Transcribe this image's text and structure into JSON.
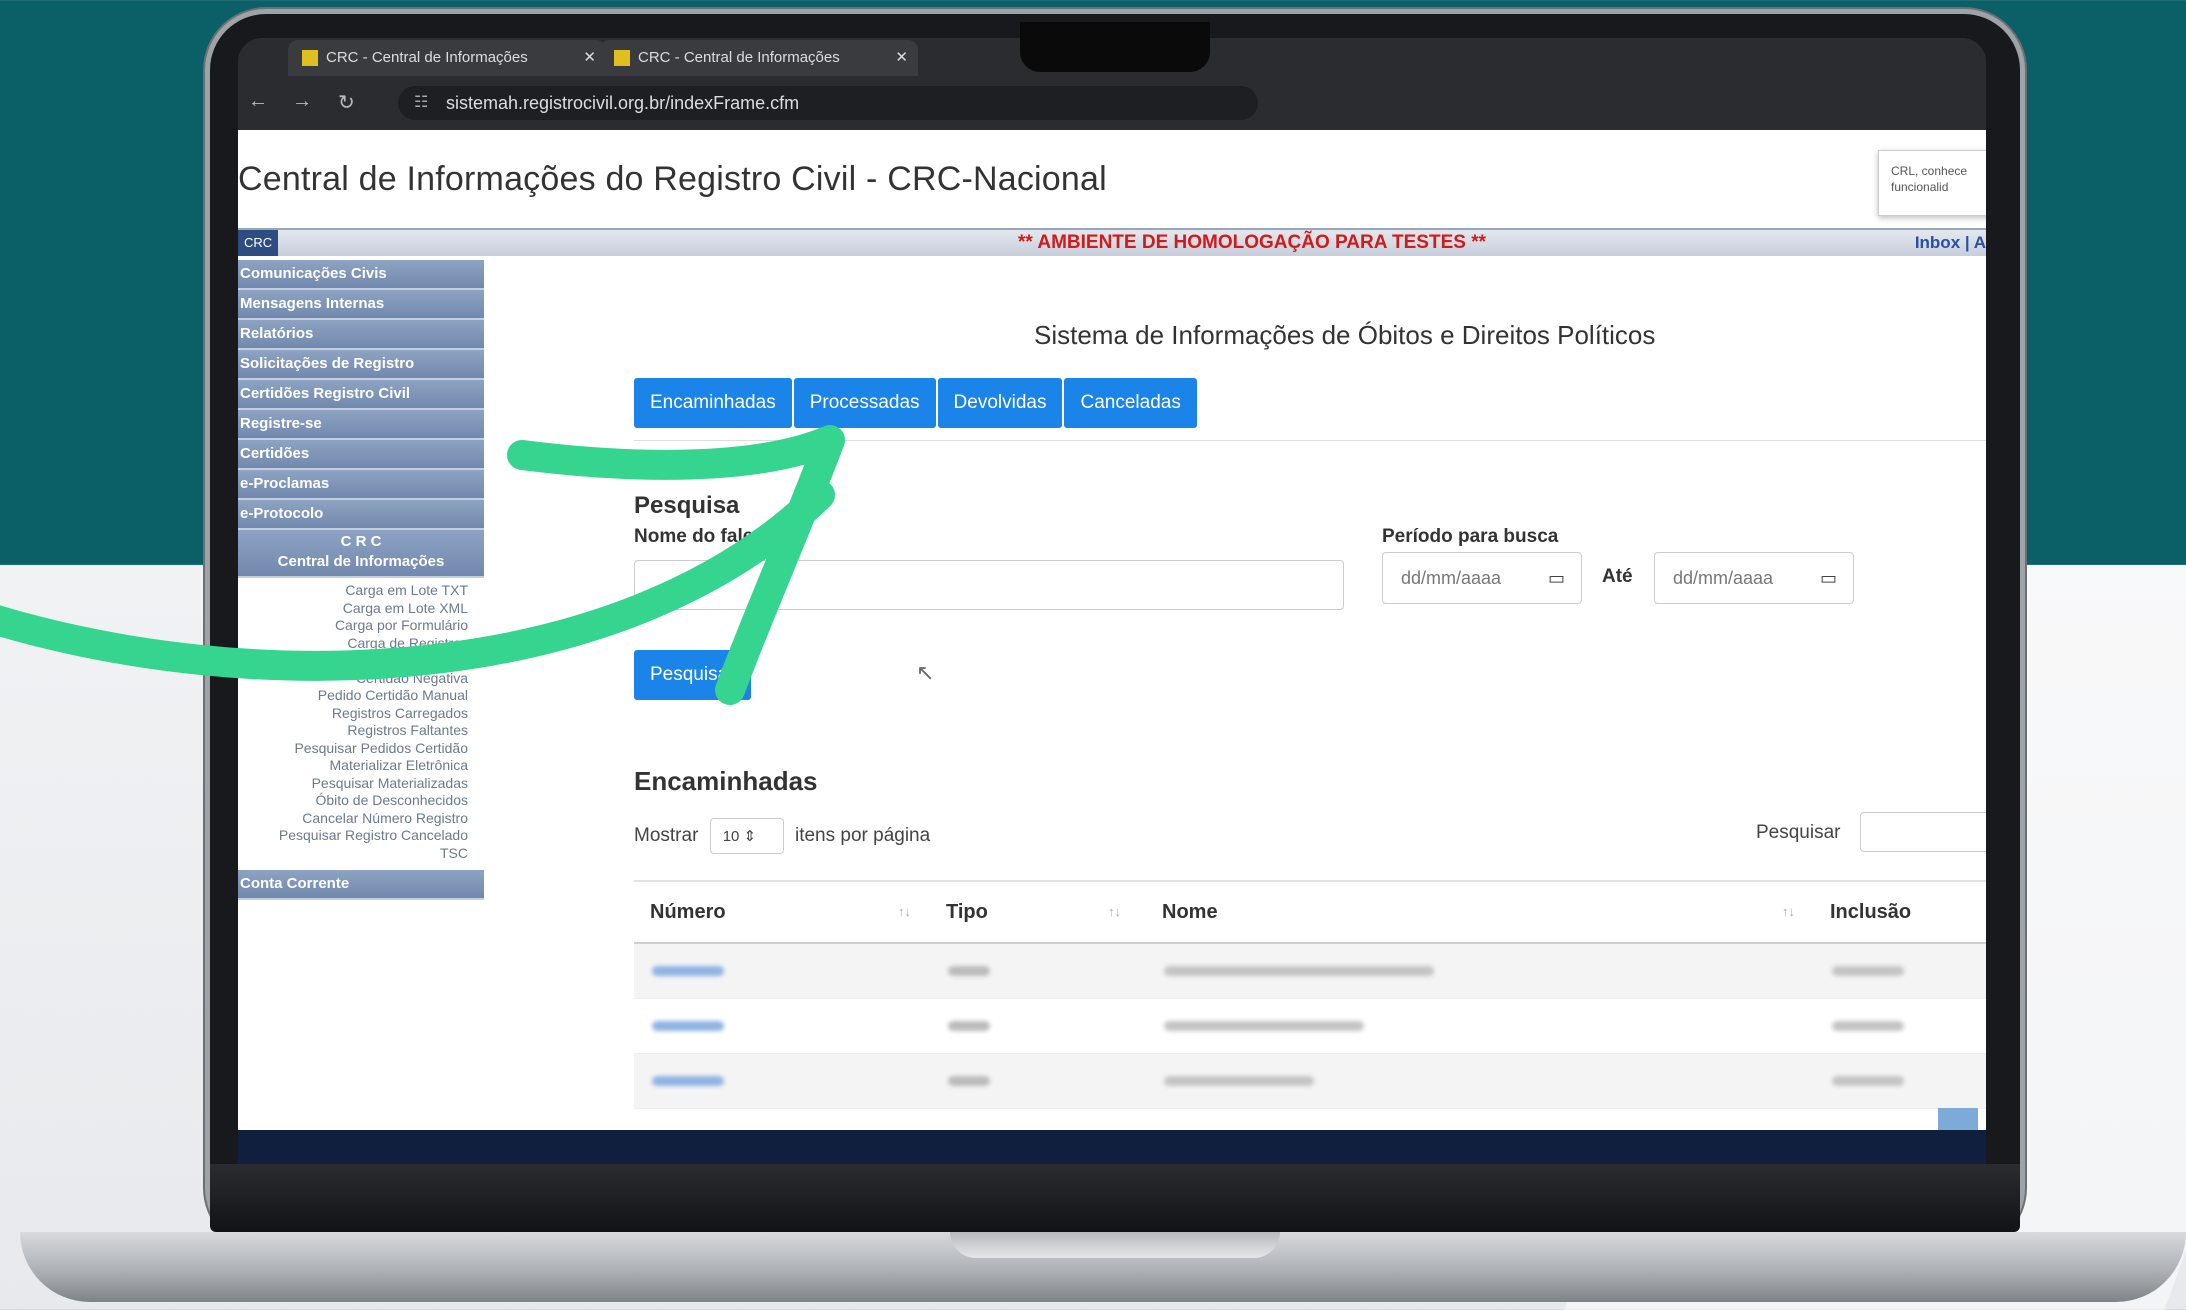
{
  "browser": {
    "tabs": [
      "CRC - Central de Informações",
      "CRC - Central de Informações"
    ],
    "url": "sistemah.registrocivil.org.br/indexFrame.cfm"
  },
  "site": {
    "title": "Central de Informações do Registro Civil - CRC-Nacional",
    "notice": "CRL, conhece funcionalid",
    "badge": "CRC",
    "env_warning": "** AMBIENTE DE HOMOLOGAÇÃO PARA TESTES **",
    "inbox_link": "Inbox  |  A"
  },
  "sidebar": {
    "items": [
      "Comunicações Civis",
      "Mensagens Internas",
      "Relatórios",
      "Solicitações de Registro",
      "Certidões Registro Civil",
      "Registre-se",
      "Certidões",
      "e-Proclamas",
      "e-Protocolo"
    ],
    "group": {
      "line1": "C R C",
      "line2": "Central de Informações"
    },
    "sub_items": [
      "Carga em Lote TXT",
      "Carga em Lote XML",
      "Carga por Formulário",
      "Carga de Registros",
      "Pesquisar Registros",
      "Certidão Negativa",
      "Pedido Certidão Manual",
      "Registros Carregados",
      "Registros Faltantes",
      "Pesquisar Pedidos Certidão",
      "Materializar Eletrônica",
      "Pesquisar Materializadas",
      "Óbito de Desconhecidos",
      "Cancelar Número Registro",
      "Pesquisar Registro Cancelado",
      "TSC"
    ],
    "last_item": "Conta Corrente"
  },
  "main": {
    "system_title": "Sistema de Informações de Óbitos e Direitos Políticos",
    "tabs": [
      "Encaminhadas",
      "Processadas",
      "Devolvidas",
      "Canceladas"
    ],
    "search_heading": "Pesquisa",
    "name_label": "Nome do falecido",
    "period_label": "Período para busca",
    "date_placeholder": "dd/mm/aaaa",
    "until_label": "Até",
    "search_button": "Pesquisar",
    "section_title": "Encaminhadas",
    "show_label": "Mostrar",
    "per_page_value": "10",
    "per_page_suffix": "itens por página",
    "table_search_label": "Pesquisar",
    "columns": [
      "Número",
      "Tipo",
      "Nome",
      "Inclusão"
    ]
  },
  "colors": {
    "primary_button": "#1a84e8",
    "arrow": "#35d48f",
    "background_top": "#0b5f66",
    "warning": "#d21a1a"
  }
}
